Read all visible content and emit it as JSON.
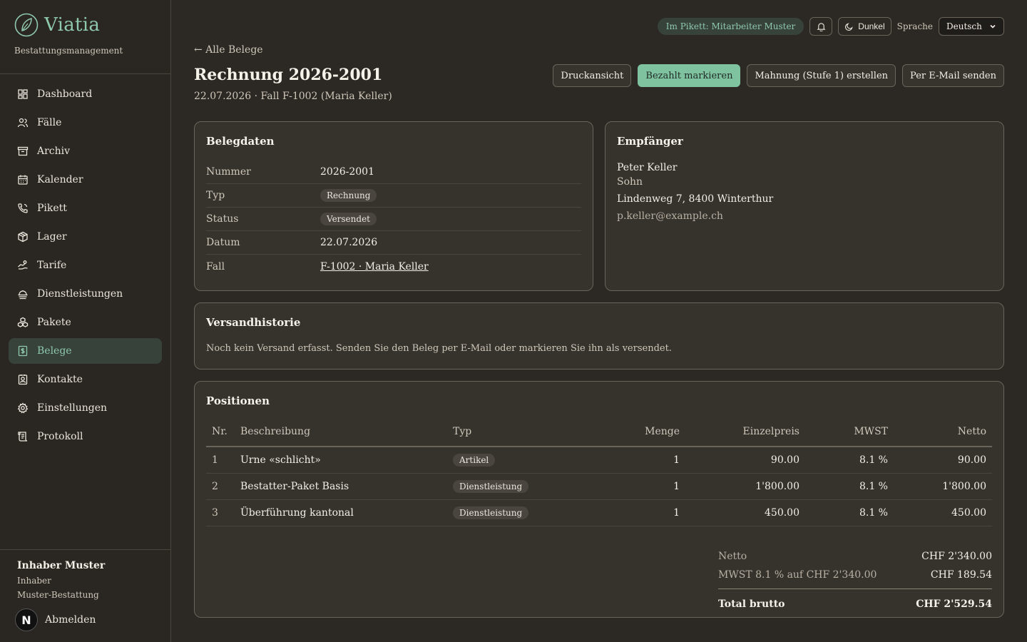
{
  "brand": {
    "name": "Viatia",
    "subtitle": "Bestattungsmanagement"
  },
  "nav": [
    {
      "label": "Dashboard",
      "icon": "dashboard-icon"
    },
    {
      "label": "Fälle",
      "icon": "users-icon"
    },
    {
      "label": "Archiv",
      "icon": "archive-icon"
    },
    {
      "label": "Kalender",
      "icon": "calendar-icon"
    },
    {
      "label": "Pikett",
      "icon": "phone-icon"
    },
    {
      "label": "Lager",
      "icon": "package-icon"
    },
    {
      "label": "Tarife",
      "icon": "tariff-icon"
    },
    {
      "label": "Dienstleistungen",
      "icon": "service-icon"
    },
    {
      "label": "Pakete",
      "icon": "packages-icon"
    },
    {
      "label": "Belege",
      "icon": "receipt-icon",
      "active": true
    },
    {
      "label": "Kontakte",
      "icon": "contact-icon"
    },
    {
      "label": "Einstellungen",
      "icon": "gear-icon"
    },
    {
      "label": "Protokoll",
      "icon": "log-icon"
    }
  ],
  "user": {
    "name": "Inhaber Muster",
    "role": "Inhaber",
    "org": "Muster-Bestattung",
    "logout": "Abmelden",
    "badge": "N"
  },
  "topbar": {
    "pikett": "Im Pikett: Mitarbeiter Muster",
    "theme": "Dunkel",
    "language_label": "Sprache",
    "language_value": "Deutsch"
  },
  "header": {
    "back": "← Alle Belege",
    "title": "Rechnung 2026-2001",
    "subtitle": "22.07.2026 · Fall F-1002 (Maria Keller)"
  },
  "actions": {
    "print": "Druckansicht",
    "paid": "Bezahlt markieren",
    "reminder": "Mahnung (Stufe 1) erstellen",
    "email": "Per E-Mail senden"
  },
  "belegdaten": {
    "title": "Belegdaten",
    "rows": {
      "nummer": {
        "key": "Nummer",
        "value": "2026-2001"
      },
      "typ": {
        "key": "Typ",
        "value": "Rechnung"
      },
      "status": {
        "key": "Status",
        "value": "Versendet"
      },
      "datum": {
        "key": "Datum",
        "value": "22.07.2026"
      },
      "fall": {
        "key": "Fall",
        "value": "F-1002 · Maria Keller"
      }
    }
  },
  "empfaenger": {
    "title": "Empfänger",
    "name": "Peter Keller",
    "relation": "Sohn",
    "address": "Lindenweg 7, 8400 Winterthur",
    "email": "p.keller@example.ch"
  },
  "versand": {
    "title": "Versandhistorie",
    "text": "Noch kein Versand erfasst. Senden Sie den Beleg per E-Mail oder markieren Sie ihn als versendet."
  },
  "positionen": {
    "title": "Positionen",
    "columns": [
      "Nr.",
      "Beschreibung",
      "Typ",
      "Menge",
      "Einzelpreis",
      "MWST",
      "Netto"
    ],
    "rows": [
      {
        "nr": "1",
        "desc": "Urne «schlicht»",
        "typ": "Artikel",
        "menge": "1",
        "preis": "90.00",
        "mwst": "8.1 %",
        "netto": "90.00"
      },
      {
        "nr": "2",
        "desc": "Bestatter-Paket Basis",
        "typ": "Dienstleistung",
        "menge": "1",
        "preis": "1'800.00",
        "mwst": "8.1 %",
        "netto": "1'800.00"
      },
      {
        "nr": "3",
        "desc": "Überführung kantonal",
        "typ": "Dienstleistung",
        "menge": "1",
        "preis": "450.00",
        "mwst": "8.1 %",
        "netto": "450.00"
      }
    ],
    "totals": {
      "netto_label": "Netto",
      "netto": "CHF 2'340.00",
      "mwst_label": "MWST 8.1 % auf CHF 2'340.00",
      "mwst": "CHF 189.54",
      "total_label": "Total brutto",
      "total": "CHF 2'529.54"
    }
  },
  "colors": {
    "accent": "#8fc9ad",
    "primary_button": "#7fc2a0",
    "background": "#2c2924"
  }
}
